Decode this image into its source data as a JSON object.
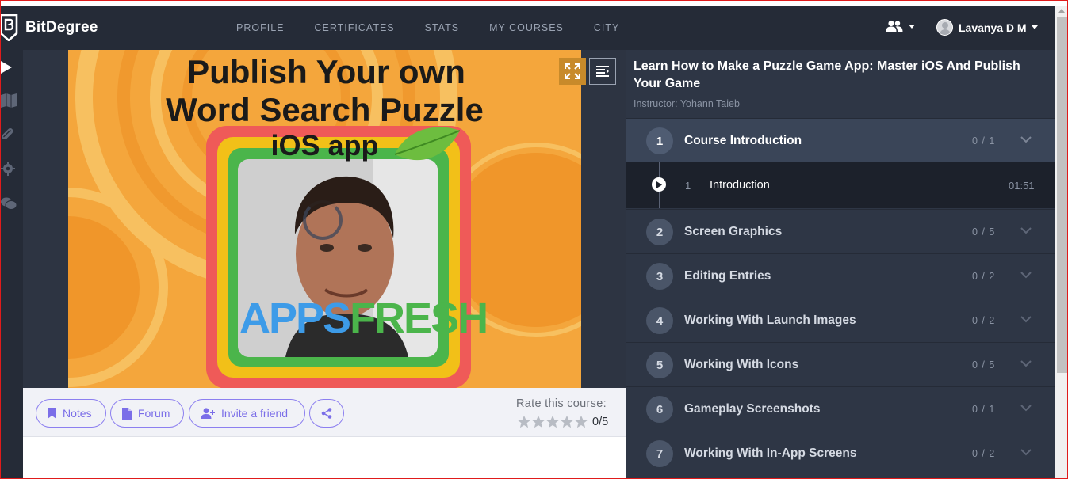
{
  "brand": {
    "name": "BitDegree"
  },
  "nav": {
    "items": [
      "PROFILE",
      "CERTIFICATES",
      "STATS",
      "MY COURSES",
      "CITY"
    ]
  },
  "user": {
    "name": "Lavanya D M"
  },
  "rail": {
    "icons": [
      "play-icon",
      "book-icon",
      "paperclip-icon",
      "gear-icon",
      "chat-icon"
    ]
  },
  "video": {
    "title_line1": "Publish Your own",
    "title_line2": "Word Search Puzzle",
    "title_line3": "iOS app",
    "logo_part1": "APPS",
    "logo_part2": "FRESH"
  },
  "actions": {
    "notes": "Notes",
    "forum": "Forum",
    "invite": "Invite a friend",
    "rate_label": "Rate this course:",
    "rate_value": "0/5",
    "stars_filled": 0,
    "stars_total": 5
  },
  "course": {
    "title": "Learn How to Make a Puzzle Game App: Master iOS And Publish Your Game",
    "instructor": "Instructor: Yohann Taieb",
    "sections": [
      {
        "num": "1",
        "title": "Course Introduction",
        "count": "0 / 1"
      },
      {
        "num": "2",
        "title": "Screen Graphics",
        "count": "0 / 5"
      },
      {
        "num": "3",
        "title": "Editing Entries",
        "count": "0 / 2"
      },
      {
        "num": "4",
        "title": "Working With Launch Images",
        "count": "0 / 2"
      },
      {
        "num": "5",
        "title": "Working With Icons",
        "count": "0 / 5"
      },
      {
        "num": "6",
        "title": "Gameplay Screenshots",
        "count": "0 / 1"
      },
      {
        "num": "7",
        "title": "Working With In-App Screens",
        "count": "0 / 2"
      }
    ],
    "active_lesson": {
      "num": "1",
      "title": "Introduction",
      "duration": "01:51"
    }
  },
  "colors": {
    "nav_bg": "#252b37",
    "panel_bg": "#2e3645",
    "accent_purple": "#7b6ee8",
    "video_orange": "#f3a43a"
  }
}
